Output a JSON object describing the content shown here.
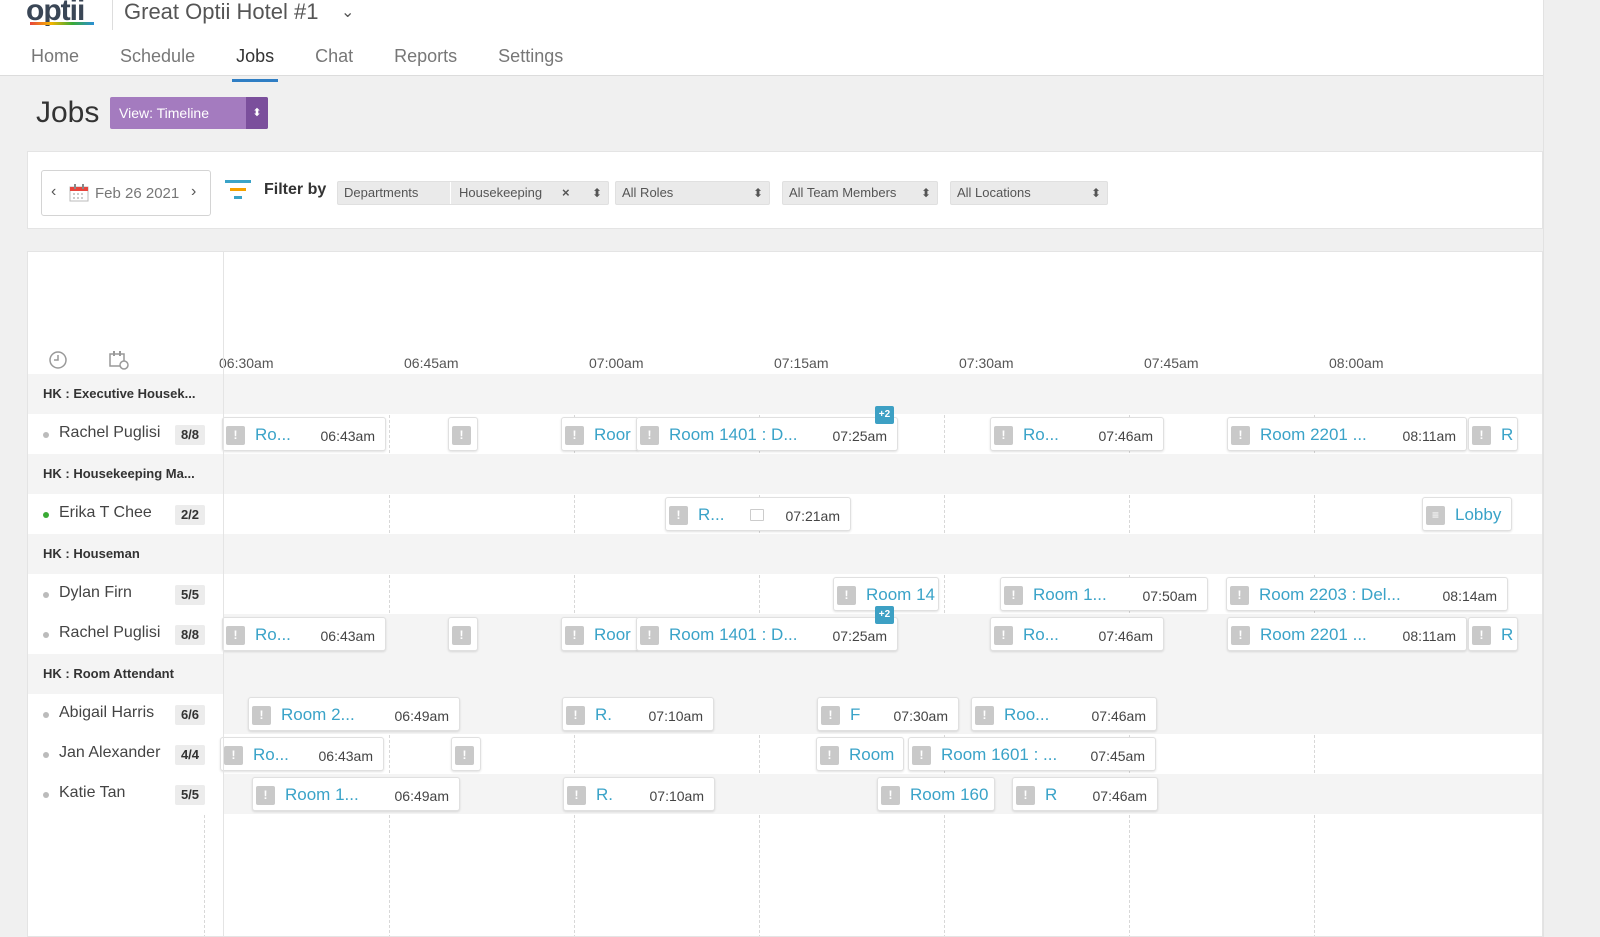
{
  "header": {
    "logo_text": "optii",
    "hotel_name": "Great Optii Hotel #1",
    "nav": [
      {
        "label": "Home"
      },
      {
        "label": "Schedule"
      },
      {
        "label": "Jobs"
      },
      {
        "label": "Chat"
      },
      {
        "label": "Reports"
      },
      {
        "label": "Settings"
      }
    ],
    "active_nav": "Jobs"
  },
  "page": {
    "title": "Jobs",
    "view_button": "View: Timeline"
  },
  "filters": {
    "date": "Feb 26 2021",
    "filter_label": "Filter by",
    "departments_label": "Departments",
    "departments_value": "Housekeeping",
    "clear_symbol": "×",
    "roles": "All Roles",
    "team_members": "All Team Members",
    "locations": "All Locations"
  },
  "timeline": {
    "times": [
      "06:30am",
      "06:45am",
      "07:00am",
      "07:15am",
      "07:30am",
      "07:45am",
      "08:00am"
    ],
    "rows": [
      {
        "type": "group",
        "name": "HK : Executive Housek..."
      },
      {
        "type": "person",
        "name": "Rachel Puglisi",
        "count": "8/8",
        "active": false
      },
      {
        "type": "group",
        "name": "HK : Housekeeping Ma..."
      },
      {
        "type": "person",
        "name": "Erika T Chee",
        "count": "2/2",
        "active": true
      },
      {
        "type": "group",
        "name": "HK : Houseman"
      },
      {
        "type": "person",
        "name": "Dylan Firn",
        "count": "5/5",
        "active": false
      },
      {
        "type": "person",
        "name": "Rachel Puglisi",
        "count": "8/8",
        "active": false
      },
      {
        "type": "group",
        "name": "HK : Room Attendant"
      },
      {
        "type": "person",
        "name": "Abigail Harris",
        "count": "6/6",
        "active": false
      },
      {
        "type": "person",
        "name": "Jan Alexander",
        "count": "4/4",
        "active": false
      },
      {
        "type": "person",
        "name": "Katie Tan",
        "count": "5/5",
        "active": false
      }
    ],
    "jobs": {
      "r1": [
        {
          "title": "Ro...",
          "time": "06:43am"
        },
        {
          "title": "",
          "time": ""
        },
        {
          "title": "Roor",
          "time": ""
        },
        {
          "title": "Room 1401 : D...",
          "time": "07:25am",
          "badge": "+2"
        },
        {
          "title": "Ro...",
          "time": "07:46am"
        },
        {
          "title": "Room 2201 ...",
          "time": "08:11am"
        },
        {
          "title": "R",
          "time": ""
        }
      ],
      "r3": [
        {
          "title": "R...",
          "time": "07:21am"
        },
        {
          "title": "Lobby",
          "time": ""
        }
      ],
      "r5": [
        {
          "title": "Room 14",
          "time": ""
        },
        {
          "title": "Room 1...",
          "time": "07:50am"
        },
        {
          "title": "Room 2203 : Del...",
          "time": "08:14am"
        }
      ],
      "r6": [
        {
          "title": "Ro...",
          "time": "06:43am"
        },
        {
          "title": "",
          "time": ""
        },
        {
          "title": "Roor",
          "time": ""
        },
        {
          "title": "Room 1401 : D...",
          "time": "07:25am",
          "badge": "+2"
        },
        {
          "title": "Ro...",
          "time": "07:46am"
        },
        {
          "title": "Room 2201 ...",
          "time": "08:11am"
        },
        {
          "title": "R",
          "time": ""
        }
      ],
      "r8": [
        {
          "title": "Room 2...",
          "time": "06:49am"
        },
        {
          "title": "R.",
          "time": "07:10am"
        },
        {
          "title": "F",
          "time": "07:30am"
        },
        {
          "title": "Roo...",
          "time": "07:46am"
        }
      ],
      "r9": [
        {
          "title": "Ro...",
          "time": "06:43am"
        },
        {
          "title": "",
          "time": ""
        },
        {
          "title": "Room",
          "time": ""
        },
        {
          "title": "Room 1601 : ...",
          "time": "07:45am"
        }
      ],
      "r10": [
        {
          "title": "Room 1...",
          "time": "06:49am"
        },
        {
          "title": "R.",
          "time": "07:10am"
        },
        {
          "title": "Room 160",
          "time": ""
        },
        {
          "title": "R",
          "time": "07:46am"
        }
      ]
    }
  },
  "colors": {
    "accent_purple": "#a47bbf",
    "accent_purple_dark": "#7b4f9c",
    "link_blue": "#3aa3c8",
    "nav_underline": "#2f7ec4",
    "badge_blue": "#3da0c4"
  }
}
